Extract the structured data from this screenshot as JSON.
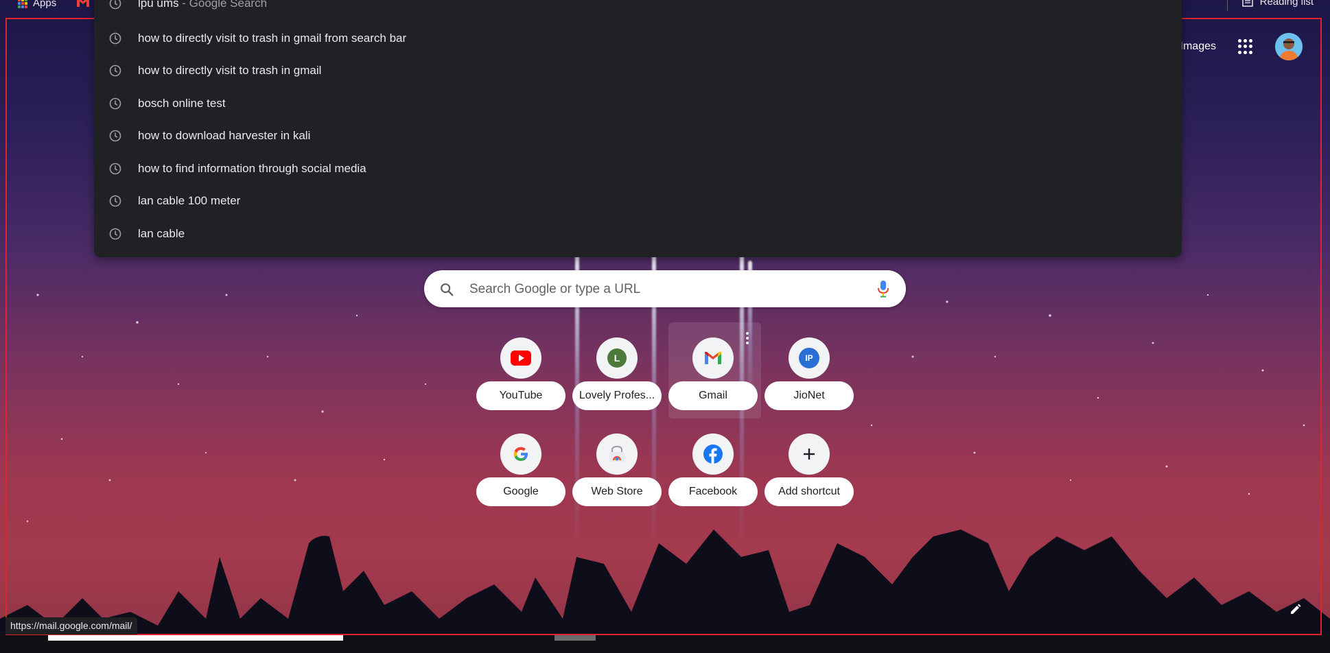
{
  "bookmarks_bar": {
    "apps_label": "Apps",
    "reading_list_label": "Reading list"
  },
  "header": {
    "images_label": "Images",
    "apps_icon": "google-apps-grid-icon",
    "avatar_icon": "user-avatar"
  },
  "omnibox_dropdown": {
    "top_item": {
      "query": "lpu ums",
      "suffix": " - Google Search"
    },
    "history_items": [
      "how to directly visit to trash in gmail from search bar",
      "how to directly visit to trash in gmail",
      "bosch online test",
      "how to download harvester in kali",
      "how to find information through social media",
      "lan cable 100 meter",
      "lan cable"
    ],
    "item_icon": "clock-history-icon"
  },
  "search": {
    "placeholder": "Search Google or type a URL"
  },
  "shortcuts": [
    {
      "label": "YouTube",
      "icon": "youtube-icon"
    },
    {
      "label": "Lovely Profes...",
      "icon": "letter-l-icon",
      "letter": "L"
    },
    {
      "label": "Gmail",
      "icon": "gmail-icon"
    },
    {
      "label": "JioNet",
      "icon": "jionet-icon",
      "letter": "IP"
    },
    {
      "label": "Google",
      "icon": "google-icon"
    },
    {
      "label": "Web Store",
      "icon": "web-store-icon"
    },
    {
      "label": "Facebook",
      "icon": "facebook-icon"
    },
    {
      "label": "Add shortcut",
      "icon": "plus-icon"
    }
  ],
  "status_bar": {
    "url": "https://mail.google.com/mail/"
  },
  "colors": {
    "frame": "#e0242c",
    "dropdown_bg": "#202124",
    "text_light": "#e8eaed"
  }
}
